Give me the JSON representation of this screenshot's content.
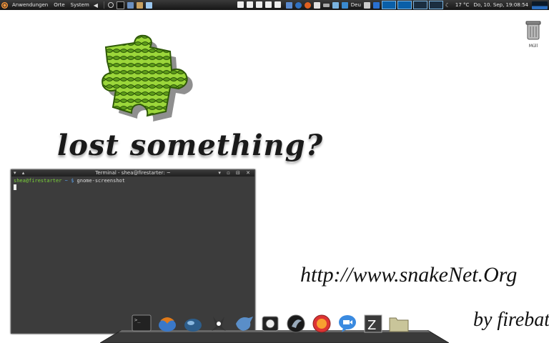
{
  "top_panel": {
    "menus": [
      "Anwendungen",
      "Orte",
      "System"
    ],
    "keyboard_layout": "Deu",
    "temperature": "17 °C",
    "clock": "Do, 10. Sep, 19:08:54"
  },
  "desktop": {
    "tagline": "lost something?",
    "url": "http://www.snakeNet.Org",
    "author": "by firebat",
    "trash_label": "Müll"
  },
  "terminal": {
    "title": "Terminal - shea@firestarter: ~",
    "prompt_user": "shea@firestarter",
    "prompt_path": "~",
    "prompt_symbol": "$",
    "command": "gnome-screenshot"
  },
  "dock": {
    "items": [
      "terminal",
      "thunderbird",
      "web-browser",
      "inkscape",
      "pidgin",
      "camera",
      "amarok",
      "firefox",
      "chat",
      "filezilla",
      "folder"
    ]
  },
  "colors": {
    "panel_bg": "#1e1e1e",
    "terminal_bg": "#3c3c3c",
    "prompt_user": "#7bd33a",
    "workspace_active": "#0a5fa8"
  }
}
